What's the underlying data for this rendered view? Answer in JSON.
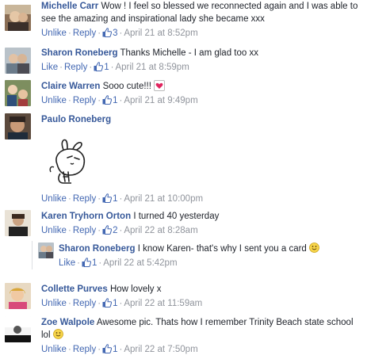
{
  "comments": [
    {
      "author": "Michelle Carr",
      "text_line1": "Wow ! I feel so blessed we reconnected again and I was able to",
      "text_line2": "see the amazing and inspirational lady she became xxx",
      "action": "Unlike",
      "reply": "Reply",
      "likes": "3",
      "time": "April 21 at 8:52pm"
    },
    {
      "author": "Sharon Roneberg",
      "text": "Thanks Michelle - I am glad too xx",
      "action": "Like",
      "reply": "Reply",
      "likes": "1",
      "time": "April 21 at 8:59pm"
    },
    {
      "author": "Claire Warren",
      "text": "Sooo cute!!!",
      "action": "Unlike",
      "reply": "Reply",
      "likes": "1",
      "time": "April 21 at 9:49pm"
    },
    {
      "author": "Paulo Roneberg",
      "action": "Unlike",
      "reply": "Reply",
      "likes": "1",
      "time": "April 21 at 10:00pm"
    },
    {
      "author": "Karen Tryhorn Orton",
      "text": "I turned 40 yesterday",
      "action": "Unlike",
      "reply": "Reply",
      "likes": "2",
      "time": "April 22 at 8:28am"
    },
    {
      "author": "Sharon Roneberg",
      "text": "I know Karen- that's why I sent you a card",
      "action": "Like",
      "reply": "Reply",
      "likes": "1",
      "time": "April 22 at 5:42pm"
    },
    {
      "author": "Collette Purves",
      "text": "How lovely x",
      "action": "Unlike",
      "reply": "Reply",
      "likes": "1",
      "time": "April 22 at 11:59am"
    },
    {
      "author": "Zoe Walpole",
      "text_line1": "Awesome pic. Thats how I remember Trinity Beach state school",
      "text_line2": "lol",
      "action": "Unlike",
      "reply": "Reply",
      "likes": "1",
      "time": "April 22 at 7:50pm"
    }
  ],
  "colors": {
    "author": "#365899",
    "action": "#4267b2",
    "meta": "#90949c",
    "text": "#1d2129"
  }
}
